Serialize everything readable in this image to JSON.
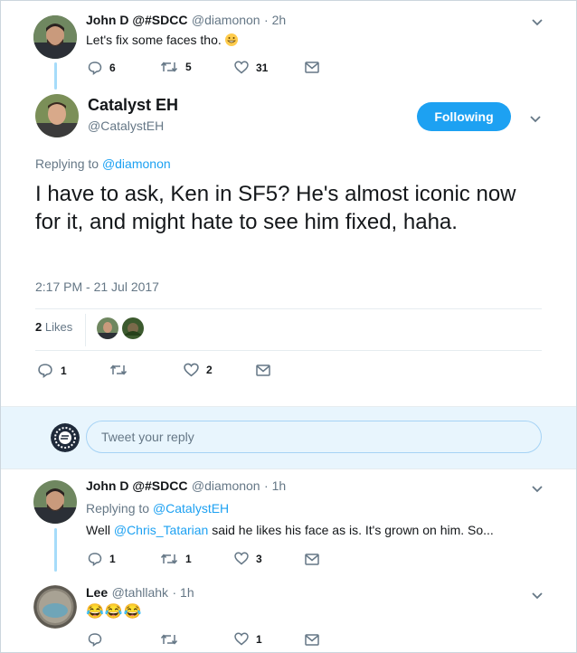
{
  "tweet1": {
    "name": "John D @#SDCC",
    "handle": "@diamonon",
    "time": "· 2h",
    "text": "Let's fix some faces tho.",
    "emoji": "😁",
    "replies": "6",
    "retweets": "5",
    "likes": "31"
  },
  "main": {
    "name": "Catalyst EH",
    "handle": "@CatalystEH",
    "follow_label": "Following",
    "replying_prefix": "Replying to",
    "replying_to": "@diamonon",
    "text": "I have to ask, Ken in SF5? He's almost iconic now for it, and might hate to see him fixed, haha.",
    "timestamp": "2:17 PM - 21 Jul 2017",
    "likes_count": "2",
    "likes_label": "Likes",
    "replies": "1",
    "retweets": "",
    "likes": "2"
  },
  "reply_box": {
    "placeholder": "Tweet your reply"
  },
  "tweet2": {
    "name": "John D @#SDCC",
    "handle": "@diamonon",
    "time": "· 1h",
    "replying_prefix": "Replying to",
    "replying_to": "@CatalystEH",
    "text_before": "Well ",
    "mention": "@Chris_Tatarian",
    "text_after": " said he likes his face as is.  It's grown on him.  So...",
    "replies": "1",
    "retweets": "1",
    "likes": "3"
  },
  "tweet3": {
    "name": "Lee",
    "handle": "@tahllahk",
    "time": "· 1h",
    "emoji_text": "😂😂😂",
    "replies": "",
    "retweets": "",
    "likes": "1"
  },
  "colors": {
    "accent": "#1da1f2",
    "muted": "#657786",
    "thread": "#a6dcfa",
    "separator": "#e6ecf0"
  }
}
